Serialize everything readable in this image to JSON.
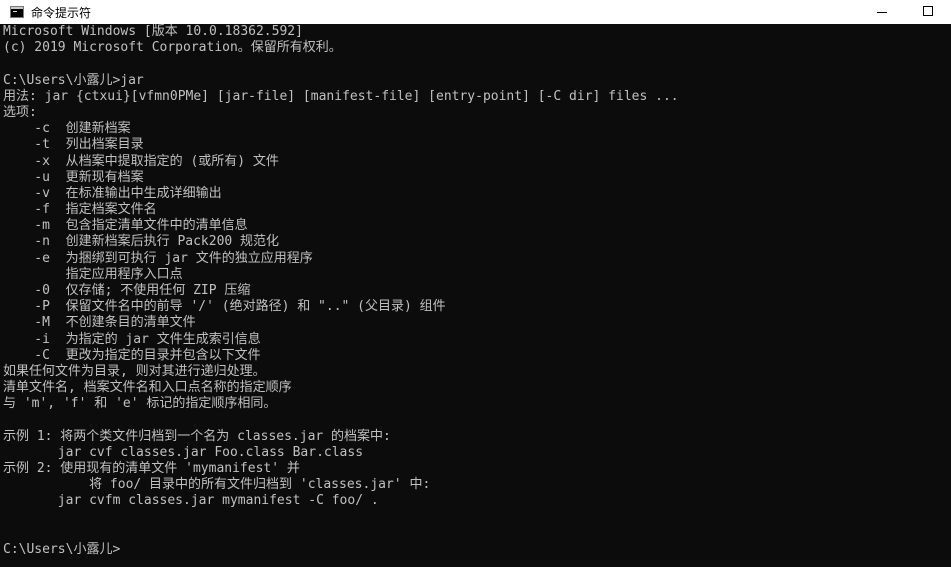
{
  "window": {
    "title": "命令提示符",
    "icon": "cmd-icon",
    "controls": [
      "minimize-icon",
      "maximize-icon"
    ]
  },
  "colors": {
    "background": "#0c0c0c",
    "text": "#c0c0c0",
    "titlebar": "#ffffff"
  },
  "console": {
    "lines": [
      "Microsoft Windows [版本 10.0.18362.592]",
      "(c) 2019 Microsoft Corporation。保留所有权利。",
      "",
      "C:\\Users\\小露儿>jar",
      "用法: jar {ctxui}[vfmn0PMe] [jar-file] [manifest-file] [entry-point] [-C dir] files ...",
      "选项:",
      "    -c  创建新档案",
      "    -t  列出档案目录",
      "    -x  从档案中提取指定的 (或所有) 文件",
      "    -u  更新现有档案",
      "    -v  在标准输出中生成详细输出",
      "    -f  指定档案文件名",
      "    -m  包含指定清单文件中的清单信息",
      "    -n  创建新档案后执行 Pack200 规范化",
      "    -e  为捆绑到可执行 jar 文件的独立应用程序",
      "        指定应用程序入口点",
      "    -0  仅存储; 不使用任何 ZIP 压缩",
      "    -P  保留文件名中的前导 '/' (绝对路径) 和 \"..\" (父目录) 组件",
      "    -M  不创建条目的清单文件",
      "    -i  为指定的 jar 文件生成索引信息",
      "    -C  更改为指定的目录并包含以下文件",
      "如果任何文件为目录, 则对其进行递归处理。",
      "清单文件名, 档案文件名和入口点名称的指定顺序",
      "与 'm', 'f' 和 'e' 标记的指定顺序相同。",
      "",
      "示例 1: 将两个类文件归档到一个名为 classes.jar 的档案中:",
      "       jar cvf classes.jar Foo.class Bar.class",
      "示例 2: 使用现有的清单文件 'mymanifest' 并",
      "           将 foo/ 目录中的所有文件归档到 'classes.jar' 中:",
      "       jar cvfm classes.jar mymanifest -C foo/ .",
      "",
      "",
      "C:\\Users\\小露儿>"
    ]
  }
}
